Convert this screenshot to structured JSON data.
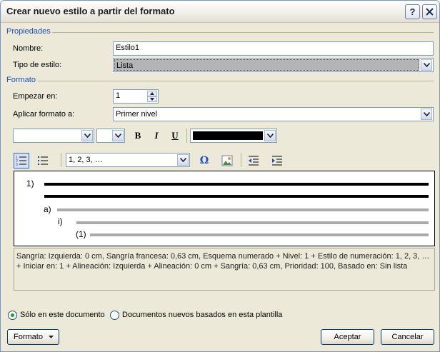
{
  "window": {
    "title": "Crear nuevo estilo a partir del formato"
  },
  "propiedades": {
    "section_label": "Propiedades",
    "nombre_label": "Nombre:",
    "nombre_value": "Estilo1",
    "tipo_label": "Tipo de estilo:",
    "tipo_value": "Lista"
  },
  "formato": {
    "section_label": "Formato",
    "empezar_label": "Empezar en:",
    "empezar_value": "1",
    "aplicar_label": "Aplicar formato a:",
    "aplicar_value": "Primer nivel",
    "font_value": "",
    "size_value": "",
    "bold": "B",
    "italic": "I",
    "underline": "U",
    "color": "#000000",
    "numbering_value": "1, 2, 3, …",
    "symbol_glyph": "Ω"
  },
  "preview": {
    "level1": "1)",
    "level2": "a)",
    "level3": "i)",
    "level4": "(1)"
  },
  "description": {
    "line1": "Sangría: Izquierda:  0 cm, Sangría francesa:  0,63 cm, Esquema numerado + Nivel: 1 + Estilo de numeración: 1, 2, 3, …",
    "line2": "+ Iniciar en: 1 + Alineación: Izquierda + Alineación:  0 cm + Sangría:  0,63 cm, Prioridad: 100, Basado en: Sin lista"
  },
  "options": {
    "solo_documento": "Sólo en este documento",
    "plantilla": "Documentos nuevos basados en esta plantilla",
    "selected": "solo_documento"
  },
  "buttons": {
    "formato": "Formato",
    "aceptar": "Aceptar",
    "cancelar": "Cancelar"
  },
  "colors": {
    "section": "#1c4fbf",
    "dialog_bg": "#ece9d8",
    "preview_line_dark": "#000000",
    "preview_line_light": "#a9a9a9"
  }
}
